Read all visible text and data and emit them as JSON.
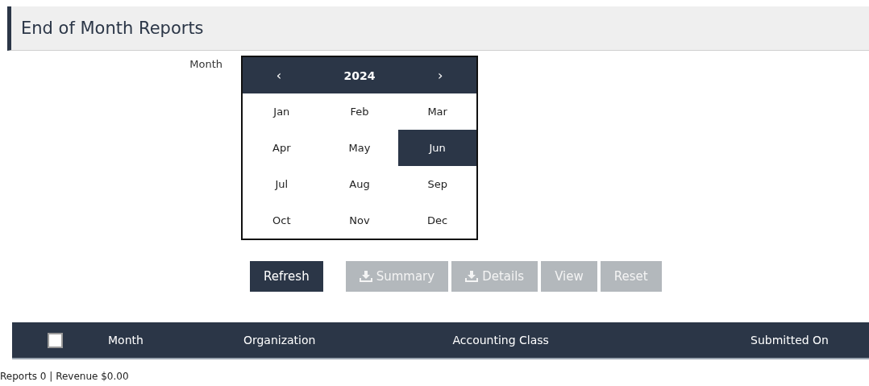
{
  "page": {
    "title": "End of Month Reports"
  },
  "month_picker": {
    "label": "Month",
    "year": "2024",
    "prev": "‹",
    "next": "›",
    "months": [
      {
        "label": "Jan",
        "selected": false
      },
      {
        "label": "Feb",
        "selected": false
      },
      {
        "label": "Mar",
        "selected": false
      },
      {
        "label": "Apr",
        "selected": false
      },
      {
        "label": "May",
        "selected": false
      },
      {
        "label": "Jun",
        "selected": true
      },
      {
        "label": "Jul",
        "selected": false
      },
      {
        "label": "Aug",
        "selected": false
      },
      {
        "label": "Sep",
        "selected": false
      },
      {
        "label": "Oct",
        "selected": false
      },
      {
        "label": "Nov",
        "selected": false
      },
      {
        "label": "Dec",
        "selected": false
      }
    ]
  },
  "buttons": [
    {
      "label": "Refresh",
      "kind": "plain",
      "disabled": false
    },
    {
      "label": "Summary",
      "kind": "download",
      "disabled": true
    },
    {
      "label": "Details",
      "kind": "download",
      "disabled": true
    },
    {
      "label": "View",
      "kind": "plain",
      "disabled": true
    },
    {
      "label": "Reset",
      "kind": "plain",
      "disabled": true
    }
  ],
  "table": {
    "select_all": {
      "checked": false
    },
    "columns": [
      "Month",
      "Organization",
      "Accounting Class",
      "Submitted On"
    ]
  },
  "summary": "Reports 0 | Revenue $0.00"
}
